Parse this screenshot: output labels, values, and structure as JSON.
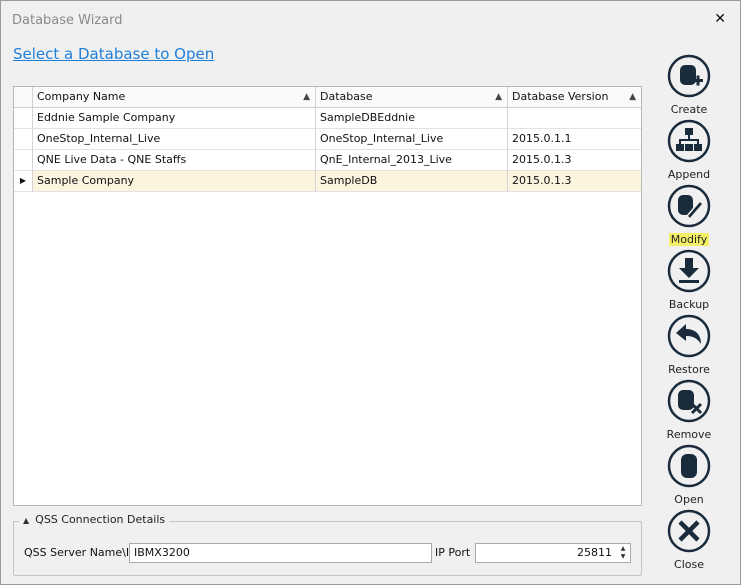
{
  "window": {
    "title": "Database Wizard",
    "close_glyph": "✕"
  },
  "heading": "Select a Database to Open",
  "grid": {
    "columns": [
      "Company Name",
      "Database",
      "Database Version"
    ],
    "rows": [
      {
        "company": "Eddnie Sample Company",
        "database": "SampleDBEddnie",
        "version": ""
      },
      {
        "company": "OneStop_Internal_Live",
        "database": "OneStop_Internal_Live",
        "version": "2015.0.1.1"
      },
      {
        "company": "QNE Live Data - QNE Staffs",
        "database": "QnE_Internal_2013_Live",
        "version": "2015.0.1.3"
      },
      {
        "company": "Sample Company",
        "database": "SampleDB",
        "version": "2015.0.1.3"
      }
    ],
    "selected_row": 3,
    "selected_indicator": "▶",
    "sort_glyph": "▲"
  },
  "qss": {
    "legend": "QSS Connection Details",
    "collapse_glyph": "▲",
    "server_label": "QSS Server Name\\IP",
    "server_value": "IBMX3200",
    "port_label": "IP Port",
    "port_value": "25811",
    "spin_up": "▲",
    "spin_down": "▼"
  },
  "toolbar": [
    {
      "label": "Create",
      "icon": "database-add-icon"
    },
    {
      "label": "Append",
      "icon": "hierarchy-icon"
    },
    {
      "label": "Modify",
      "icon": "edit-pencil-icon",
      "highlighted": true
    },
    {
      "label": "Backup",
      "icon": "download-icon"
    },
    {
      "label": "Restore",
      "icon": "undo-arrow-icon"
    },
    {
      "label": "Remove",
      "icon": "database-remove-icon"
    },
    {
      "label": "Open",
      "icon": "database-icon"
    },
    {
      "label": "Close",
      "icon": "close-circle-icon"
    }
  ],
  "colors": {
    "link": "#1e7fd9",
    "icon": "#1a2b3c",
    "selected_row": "#fdf4e0",
    "highlight": "#f4f066"
  }
}
